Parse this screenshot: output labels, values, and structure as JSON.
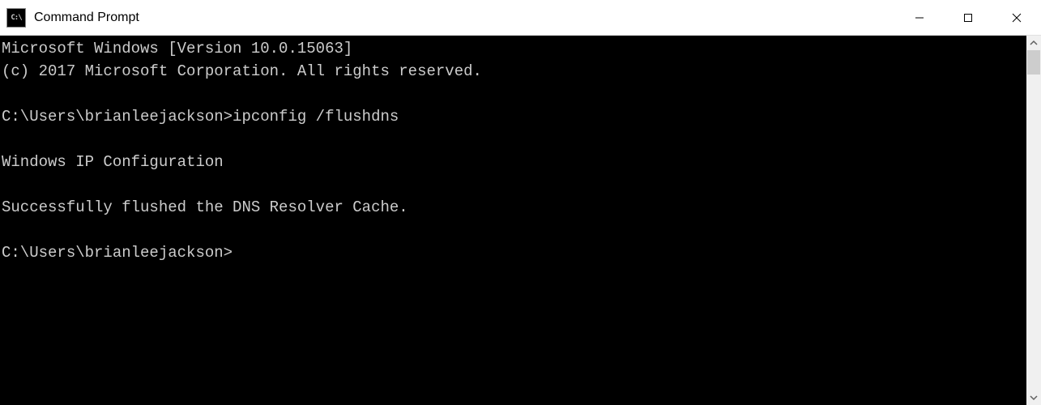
{
  "window": {
    "title": "Command Prompt",
    "icon_label": "C:\\"
  },
  "terminal": {
    "lines": [
      "Microsoft Windows [Version 10.0.15063]",
      "(c) 2017 Microsoft Corporation. All rights reserved.",
      "",
      "C:\\Users\\brianleejackson>ipconfig /flushdns",
      "",
      "Windows IP Configuration",
      "",
      "Successfully flushed the DNS Resolver Cache.",
      "",
      "C:\\Users\\brianleejackson>"
    ]
  }
}
